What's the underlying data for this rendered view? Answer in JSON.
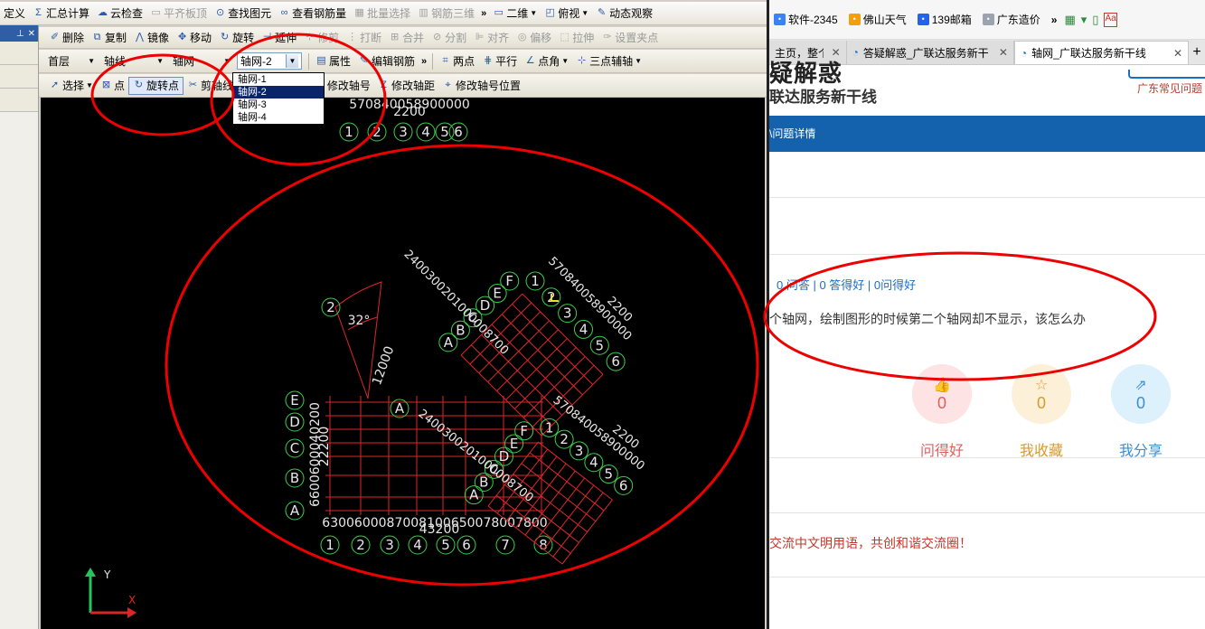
{
  "cad": {
    "toolbar1": [
      {
        "label": "定义",
        "icon": "none",
        "disabled": false
      },
      {
        "label": "汇总计算",
        "icon": "sigma-icon",
        "disabled": false
      },
      {
        "label": "云检查",
        "icon": "cloud-check-icon",
        "disabled": false
      },
      {
        "label": "平齐板顶",
        "icon": "align-top-icon",
        "disabled": true
      },
      {
        "label": "查找图元",
        "icon": "binoculars-icon",
        "disabled": false
      },
      {
        "label": "查看钢筋量",
        "icon": "rebar-view-icon",
        "disabled": false
      },
      {
        "label": "批量选择",
        "icon": "batch-select-icon",
        "disabled": true
      },
      {
        "label": "钢筋三维",
        "icon": "rebar-3d-icon",
        "disabled": true
      },
      {
        "label": "二维",
        "icon": "2d-view-icon",
        "disabled": false,
        "dropdown": true
      },
      {
        "label": "俯视",
        "icon": "cube-view-icon",
        "disabled": false,
        "dropdown": true
      },
      {
        "label": "动态观察",
        "icon": "orbit-icon",
        "disabled": false
      }
    ],
    "toolbar2": [
      {
        "label": "删除",
        "icon": "delete-icon",
        "disabled": false
      },
      {
        "label": "复制",
        "icon": "copy-icon",
        "disabled": false
      },
      {
        "label": "镜像",
        "icon": "mirror-icon",
        "disabled": false
      },
      {
        "label": "移动",
        "icon": "move-icon",
        "disabled": false
      },
      {
        "label": "旋转",
        "icon": "rotate-icon",
        "disabled": false
      },
      {
        "label": "延伸",
        "icon": "extend-icon",
        "disabled": false
      },
      {
        "label": "修剪",
        "icon": "trim-icon",
        "disabled": true
      },
      {
        "label": "打断",
        "icon": "break-icon",
        "disabled": true
      },
      {
        "label": "合并",
        "icon": "merge-icon",
        "disabled": true
      },
      {
        "label": "分割",
        "icon": "split-icon",
        "disabled": true
      },
      {
        "label": "对齐",
        "icon": "align-icon",
        "disabled": true
      },
      {
        "label": "偏移",
        "icon": "offset-icon",
        "disabled": true
      },
      {
        "label": "拉伸",
        "icon": "stretch-icon",
        "disabled": true
      },
      {
        "label": "设置夹点",
        "icon": "grip-icon",
        "disabled": true
      }
    ],
    "toolbar3": {
      "floor": "首层",
      "category": "轴线",
      "type": "轴网",
      "current_axis": "轴网-2",
      "buttons": [
        {
          "label": "属性",
          "icon": "properties-icon"
        },
        {
          "label": "编辑钢筋",
          "icon": "edit-rebar-icon"
        },
        {
          "label": "两点",
          "icon": "two-point-icon"
        },
        {
          "label": "平行",
          "icon": "parallel-icon"
        },
        {
          "label": "点角",
          "icon": "point-angle-icon",
          "dropdown": true
        },
        {
          "label": "三点辅轴",
          "icon": "three-point-axis-icon",
          "dropdown": true
        }
      ]
    },
    "toolbar4": [
      {
        "label": "选择",
        "icon": "select-arrow-icon",
        "dropdown": true
      },
      {
        "label": "点",
        "icon": "point-icon"
      },
      {
        "label": "旋转点",
        "icon": "rotate-point-icon",
        "selected": true
      },
      {
        "label": "剪轴线",
        "icon": "cut-axis-icon",
        "dropdown": true
      },
      {
        "label": "恢复轴线",
        "icon": "restore-axis-icon"
      },
      {
        "label": "修改轴号",
        "icon": "edit-axis-number-icon"
      },
      {
        "label": "修改轴距",
        "icon": "edit-axis-spacing-icon"
      },
      {
        "label": "修改轴号位置",
        "icon": "axis-number-position-icon"
      }
    ],
    "axis_dropdown": {
      "options": [
        "轴网-1",
        "轴网-2",
        "轴网-3",
        "轴网-4"
      ],
      "selected": "轴网-2"
    },
    "drawing": {
      "top_dims": "570840058900000",
      "top_total": "2200",
      "top_axes": [
        "1",
        "2",
        "3",
        "4",
        "5",
        "6"
      ],
      "bottom_dims": [
        "6300",
        "6000",
        "8700",
        "8100",
        "6500",
        "7800",
        "7800"
      ],
      "bottom_total": "43200",
      "bottom_axes": [
        "1",
        "2",
        "3",
        "4",
        "5",
        "6",
        "7",
        "8"
      ],
      "left_axes": [
        "A",
        "B",
        "C",
        "D",
        "E"
      ],
      "left_dims": "6600600040200",
      "left_total": "22200",
      "fan_angle": "32°",
      "fan_radius": "12000",
      "fan_axes": [
        "2",
        "A"
      ],
      "upper_rot_axes_num": [
        "1",
        "2",
        "3",
        "4",
        "5",
        "6"
      ],
      "upper_rot_axes_let": [
        "A",
        "B",
        "C",
        "D",
        "E",
        "F"
      ],
      "upper_rot_dims_a": "2400300201000008700",
      "upper_rot_dims_b": "570840058900000",
      "upper_rot_total": "2200",
      "lower_rot_axes_num": [
        "1",
        "2",
        "3",
        "4",
        "5",
        "6"
      ],
      "lower_rot_axes_let": [
        "A",
        "B",
        "C",
        "D",
        "E",
        "F"
      ],
      "lower_rot_dims_a": "2400300201000008700",
      "lower_rot_dims_b": "570840058900000",
      "lower_rot_total": "2200",
      "coord_x": "X",
      "coord_y": "Y"
    }
  },
  "browser": {
    "bookmarks": [
      {
        "label": "软件-2345",
        "icon": "2345-icon"
      },
      {
        "label": "佛山天气",
        "icon": "weather-icon"
      },
      {
        "label": "139邮箱",
        "icon": "mail139-icon"
      },
      {
        "label": "广东造价",
        "icon": "page-icon"
      }
    ],
    "tabs": [
      {
        "label": "主页，整个",
        "active": false
      },
      {
        "label": "答疑解惑_广联达服务新干",
        "active": false
      },
      {
        "label": "轴网_广联达服务新干线",
        "active": true
      }
    ],
    "site_title": "疑解惑",
    "site_subtitle": "联达服务新干线",
    "gd_link": "广东常见问题",
    "breadcrumb": "\\问题详情",
    "stats": "0 问答 | 0 答得好 | 0问得好",
    "question": "个轴网，绘制图形的时候第二个轴网却不显示，该怎么办",
    "actions": [
      {
        "label": "问得好",
        "count": "0",
        "color": "#e06060",
        "bg": "#fde3e3",
        "icon": "thumbs-up-icon"
      },
      {
        "label": "我收藏",
        "count": "0",
        "color": "#d89a2c",
        "bg": "#fdf0d8",
        "icon": "star-icon"
      },
      {
        "label": "我分享",
        "count": "0",
        "color": "#3d8fd1",
        "bg": "#dcf1fb",
        "icon": "share-icon"
      }
    ],
    "notice": "交流中文明用语，共创和谐交流圈！"
  }
}
